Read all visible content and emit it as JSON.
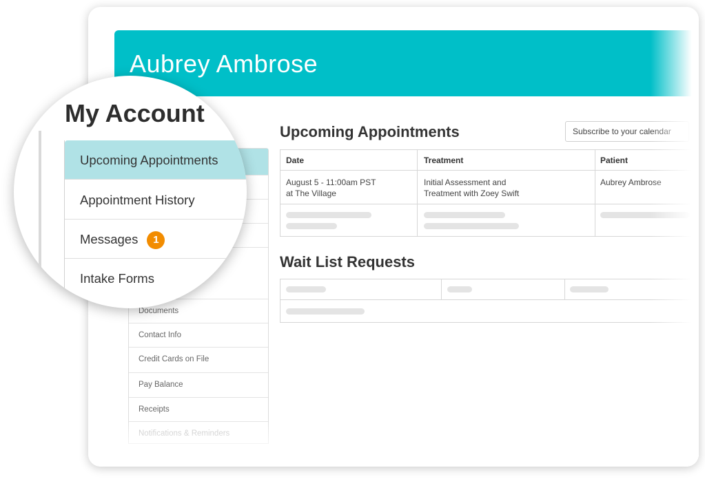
{
  "patient_name": "Aubrey Ambrose",
  "account": {
    "title": "My Account",
    "magnified_menu": [
      {
        "label": "Upcoming Appointments",
        "active": true
      },
      {
        "label": "Appointment History"
      },
      {
        "label": "Messages",
        "badge": "1"
      },
      {
        "label": "Intake Forms"
      }
    ],
    "sidebar_items": [
      "Documents",
      "Contact Info",
      "Credit Cards on File",
      "Pay Balance",
      "Receipts",
      "Notifications & Reminders"
    ]
  },
  "upcoming": {
    "title": "Upcoming Appointments",
    "subscribe_label": "Subscribe to your calendar",
    "columns": [
      "Date",
      "Treatment",
      "Patient"
    ],
    "rows": [
      {
        "date_line1": "August 5 - 11:00am PST",
        "date_line2": "at The Village",
        "treatment_line1": "Initial Assessment and",
        "treatment_line2": "Treatment with Zoey Swift",
        "patient": "Aubrey Ambrose"
      }
    ]
  },
  "waitlist": {
    "title": "Wait List Requests"
  },
  "colors": {
    "brand_teal": "#00bfc8",
    "active_item": "#b0e2e6",
    "badge_orange": "#f28c00"
  }
}
